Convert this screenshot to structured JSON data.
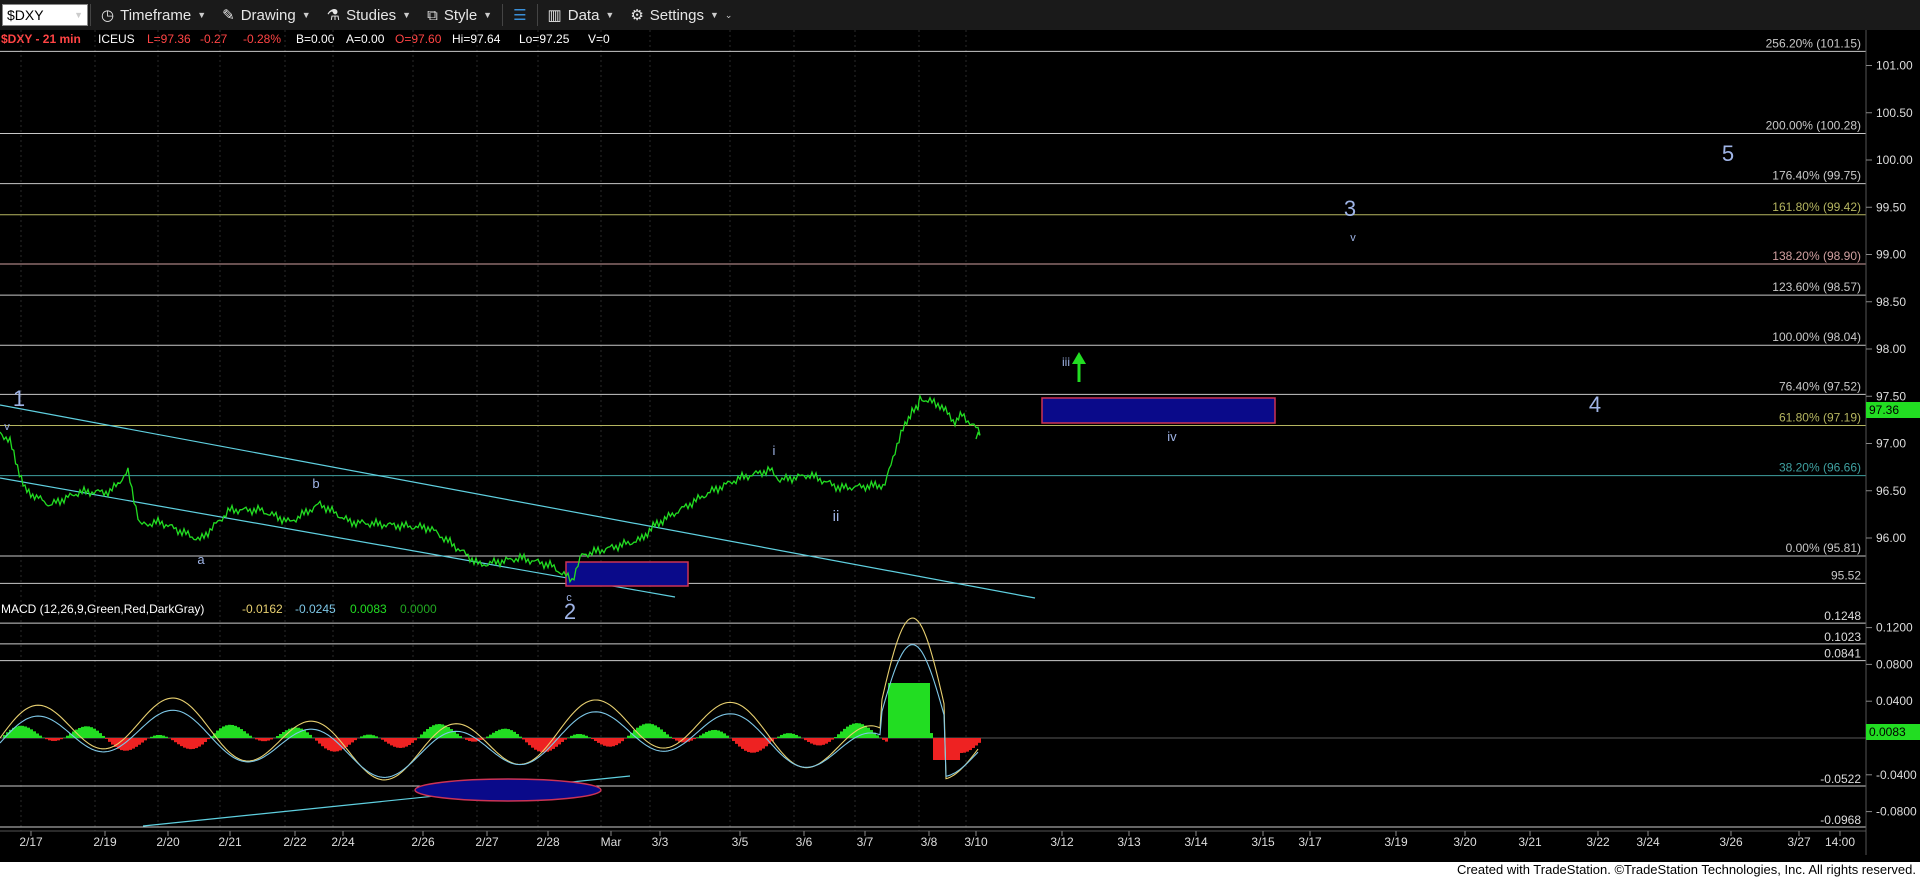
{
  "toolbar": {
    "symbol": "$DXY",
    "timeframe": "Timeframe",
    "drawing": "Drawing",
    "studies": "Studies",
    "style": "Style",
    "data": "Data",
    "settings": "Settings"
  },
  "header": {
    "symbol_interval": "$DXY - 21 min",
    "exchange": "ICEUS",
    "last": "L=97.36",
    "change": "-0.27",
    "change_pct": "-0.28%",
    "bid": "B=0.00",
    "ask": "A=0.00",
    "open": "O=97.60",
    "high": "Hi=97.64",
    "low": "Lo=97.25",
    "volume": "V=0"
  },
  "price_axis": {
    "ticks": [
      "101.00",
      "100.50",
      "100.00",
      "99.50",
      "99.00",
      "98.50",
      "98.00",
      "97.50",
      "97.00",
      "96.50",
      "96.00"
    ],
    "current_price": "97.36"
  },
  "fib_levels": [
    {
      "label": "256.20% (101.15)",
      "price": 101.15,
      "color": "#c8c8c8"
    },
    {
      "label": "200.00% (100.28)",
      "price": 100.28,
      "color": "#c8c8c8"
    },
    {
      "label": "176.40% (99.75)",
      "price": 99.75,
      "color": "#c8c8c8"
    },
    {
      "label": "161.80% (99.42)",
      "price": 99.42,
      "color": "#b5b560"
    },
    {
      "label": "138.20% (98.90)",
      "price": 98.9,
      "color": "#d0a0a0"
    },
    {
      "label": "123.60% (98.57)",
      "price": 98.57,
      "color": "#c8c8c8"
    },
    {
      "label": "100.00% (98.04)",
      "price": 98.04,
      "color": "#c8c8c8"
    },
    {
      "label": "76.40% (97.52)",
      "price": 97.52,
      "color": "#c8c8c8"
    },
    {
      "label": "61.80% (97.19)",
      "price": 97.19,
      "color": "#b5b560"
    },
    {
      "label": "38.20% (96.66)",
      "price": 96.66,
      "color": "#3fa0a0"
    },
    {
      "label": "0.00% (95.81)",
      "price": 95.81,
      "color": "#c8c8c8"
    },
    {
      "label": "95.52",
      "price": 95.52,
      "color": "#c8c8c8"
    }
  ],
  "wave_labels": [
    {
      "text": "1",
      "size": "big"
    },
    {
      "text": "v",
      "size": "small"
    },
    {
      "text": "a",
      "size": "small"
    },
    {
      "text": "b",
      "size": "small"
    },
    {
      "text": "c",
      "size": "small"
    },
    {
      "text": "2",
      "size": "big"
    },
    {
      "text": "i",
      "size": "small"
    },
    {
      "text": "ii",
      "size": "small"
    },
    {
      "text": "iii",
      "size": "small"
    },
    {
      "text": "iv",
      "size": "small"
    },
    {
      "text": "3",
      "size": "big"
    },
    {
      "text": "v",
      "size": "small"
    },
    {
      "text": "4",
      "size": "big"
    },
    {
      "text": "5",
      "size": "big"
    }
  ],
  "macd": {
    "title": "MACD (12,26,9,Green,Red,DarkGray)",
    "v1": "-0.0162",
    "v2": "-0.0245",
    "v3": "0.0083",
    "v4": "0.0000",
    "axis_ticks": [
      "0.1200",
      "0.0800",
      "0.0400",
      "-0.0400",
      "-0.0800"
    ],
    "levels": [
      "0.1248",
      "0.1023",
      "0.0841",
      "-0.0522",
      "-0.0968"
    ],
    "current": "0.0083"
  },
  "date_axis": [
    "2/17",
    "2/19",
    "2/20",
    "2/21",
    "2/22",
    "2/24",
    "2/26",
    "2/27",
    "2/28",
    "Mar",
    "3/3",
    "3/5",
    "3/6",
    "3/7",
    "3/8",
    "3/10",
    "3/12",
    "3/13",
    "3/14",
    "3/15",
    "3/17",
    "3/19",
    "3/20",
    "3/21",
    "3/22",
    "3/24",
    "3/26",
    "3/27",
    "14:00"
  ],
  "footer": "Created with TradeStation. ©TradeStation Technologies, Inc. All rights reserved.",
  "colors": {
    "price": "#22dd22",
    "macd_pos": "#22dd22",
    "macd_neg": "#ee2222",
    "box": "#0a0a8a",
    "box_border": "#cc3355",
    "trend": "#5fd0e0"
  }
}
